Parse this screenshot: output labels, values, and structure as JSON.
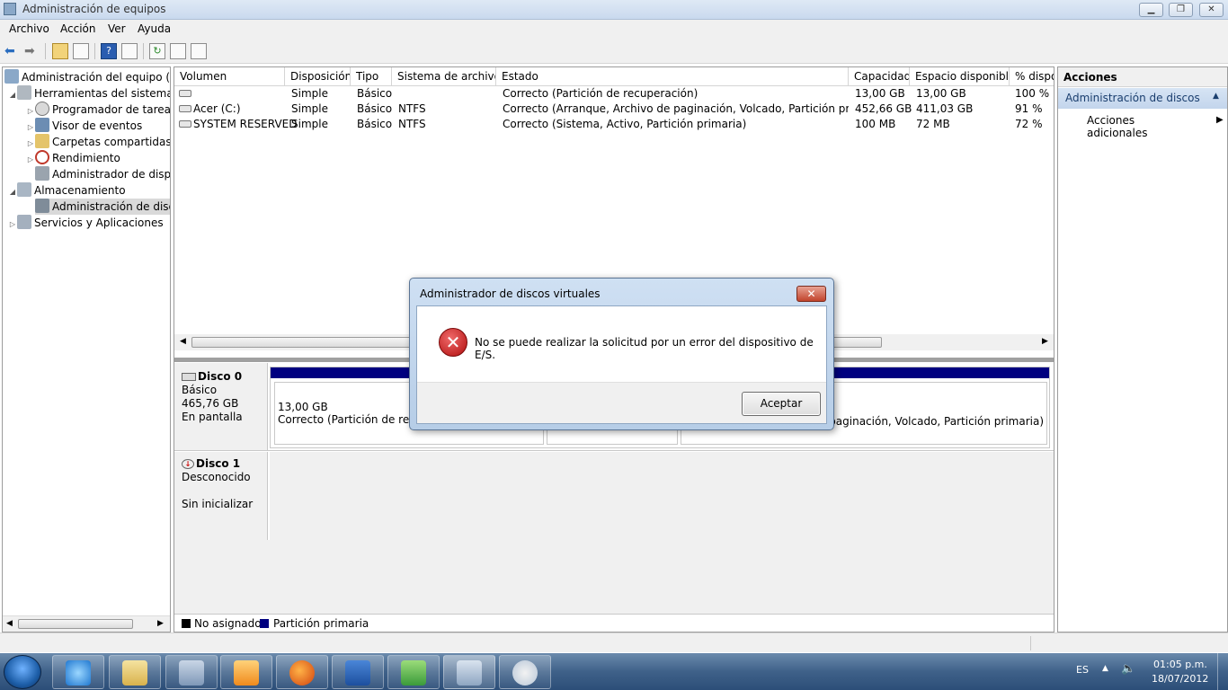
{
  "window": {
    "title": "Administración de equipos",
    "minimize": "▁",
    "maximize": "❐",
    "close": "✕"
  },
  "menu": [
    "Archivo",
    "Acción",
    "Ver",
    "Ayuda"
  ],
  "tree": [
    {
      "label": "Administración del equipo (loc",
      "level": 0,
      "arrow": ""
    },
    {
      "label": "Herramientas del sistema",
      "level": 1,
      "arrow": "◢"
    },
    {
      "label": "Programador de tareas",
      "level": 2,
      "arrow": "▷"
    },
    {
      "label": "Visor de eventos",
      "level": 2,
      "arrow": "▷"
    },
    {
      "label": "Carpetas compartidas",
      "level": 2,
      "arrow": "▷"
    },
    {
      "label": "Rendimiento",
      "level": 2,
      "arrow": "▷"
    },
    {
      "label": "Administrador de dispo",
      "level": 2,
      "arrow": ""
    },
    {
      "label": "Almacenamiento",
      "level": 1,
      "arrow": "◢"
    },
    {
      "label": "Administración de disco",
      "level": 2,
      "arrow": ""
    },
    {
      "label": "Servicios y Aplicaciones",
      "level": 1,
      "arrow": "▷"
    }
  ],
  "table": {
    "headers": [
      "Volumen",
      "Disposición",
      "Tipo",
      "Sistema de archivos",
      "Estado",
      "Capacidad",
      "Espacio disponible",
      "% dispo"
    ],
    "rows": [
      [
        "",
        "Simple",
        "Básico",
        "",
        "Correcto (Partición de recuperación)",
        "13,00 GB",
        "13,00 GB",
        "100 %"
      ],
      [
        "Acer (C:)",
        "Simple",
        "Básico",
        "NTFS",
        "Correcto (Arranque, Archivo de paginación, Volcado, Partición primaria)",
        "452,66 GB",
        "411,03 GB",
        "91 %"
      ],
      [
        "SYSTEM RESERVED",
        "Simple",
        "Básico",
        "NTFS",
        "Correcto (Sistema, Activo, Partición primaria)",
        "100 MB",
        "72 MB",
        "72 %"
      ]
    ]
  },
  "disks": {
    "disk0": {
      "name": "Disco 0",
      "type": "Básico",
      "size": "465,76 GB",
      "state": "En pantalla",
      "part1_size": "13,00 GB",
      "part1_status": "Correcto (Partición de recup",
      "part3_status": "paginación, Volcado, Partición primaria)"
    },
    "disk1": {
      "name": "Disco 1",
      "type": "Desconocido",
      "state": "Sin inicializar"
    }
  },
  "legend": {
    "unassigned": "No asignado",
    "primary": "Partición primaria"
  },
  "actions": {
    "title": "Acciones",
    "section": "Administración de discos",
    "more": "Acciones adicionales"
  },
  "dialog": {
    "title": "Administrador de discos virtuales",
    "message": "No se puede realizar la solicitud por un error del dispositivo de E/S.",
    "ok": "Aceptar",
    "close": "✕"
  },
  "taskbar": {
    "lang": "ES",
    "time": "01:05 p.m.",
    "date": "18/07/2012"
  },
  "colors": {
    "primary_partition": "#000080",
    "unassigned": "#000000",
    "error": "#c00000"
  }
}
